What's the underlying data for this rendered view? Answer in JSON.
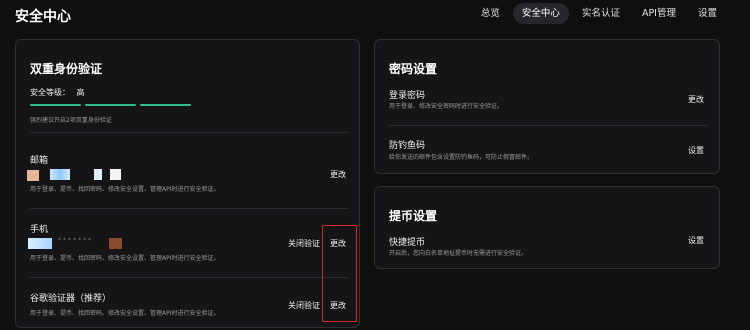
{
  "header": {
    "title": "安全中心",
    "tabs": [
      "总览",
      "安全中心",
      "实名认证",
      "API管理",
      "设置"
    ],
    "active_tab": "安全中心"
  },
  "two_factor": {
    "title": "双重身份验证",
    "level_label": "安全等级：",
    "level_value": "高",
    "level_bars": 3,
    "tip": "强烈建议开启2项双重身份验证",
    "email": {
      "label": "邮箱",
      "desc": "用于登录、提币、找回密码、修改安全设置、管理API时进行安全验证。",
      "change": "更改"
    },
    "phone": {
      "label": "手机",
      "masked": "*******",
      "desc": "用于登录、提币、找回密码、修改安全设置、管理API时进行安全验证。",
      "disable": "关闭验证",
      "change": "更改"
    },
    "google": {
      "label": "谷歌验证器（推荐）",
      "desc": "用于登录、提币、找回密码、修改安全设置、管理API时进行安全验证。",
      "disable": "关闭验证",
      "change": "更改"
    }
  },
  "password_settings": {
    "title": "密码设置",
    "login": {
      "label": "登录密码",
      "desc": "用于登录、修改安全密码时进行安全验证。",
      "action": "更改"
    },
    "antiphish": {
      "label": "防钓鱼码",
      "desc": "给你发送的邮件包含设置防钓鱼码，可防止假冒邮件。",
      "action": "设置"
    }
  },
  "withdraw_settings": {
    "title": "提币设置",
    "quick": {
      "label": "快捷提币",
      "desc": "开启后，您向白名单地址提币时无需进行安全验证。",
      "action": "设置"
    }
  },
  "colors": {
    "background": "#0f0f10",
    "card": "#151517",
    "accent_green": "#2fbf8f",
    "highlight_red": "#d22a2a"
  }
}
